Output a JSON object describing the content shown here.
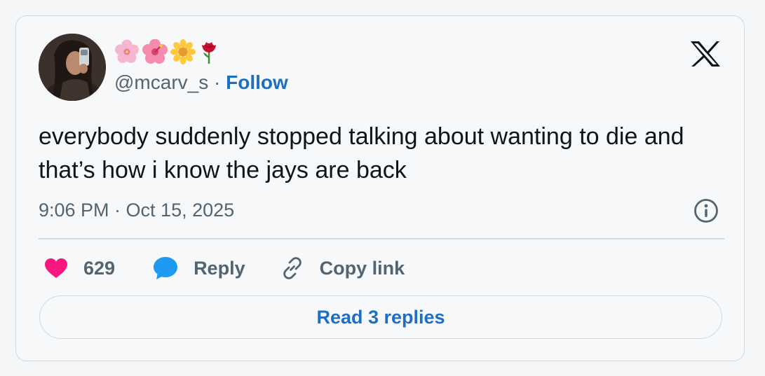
{
  "author": {
    "display_name_emojis": [
      "cherry-blossom",
      "hibiscus",
      "sunflower",
      "rose"
    ],
    "handle": "@mcarv_s",
    "separator": "·",
    "follow_label": "Follow"
  },
  "tweet": {
    "text": "everybody suddenly stopped talking about wanting to die and that’s how i know the jays are back",
    "timestamp": "9:06 PM · Oct 15, 2025"
  },
  "actions": {
    "like_count": "629",
    "reply_label": "Reply",
    "copy_link_label": "Copy link"
  },
  "read_replies_label": "Read 3 replies",
  "colors": {
    "like": "#f91880",
    "reply": "#1d9bf0",
    "link": "#1d6fc2",
    "secondary_text": "#536471",
    "primary_text": "#0f1419",
    "border": "#cfd9de"
  },
  "icons": {
    "brand": "x-logo",
    "info": "info-icon",
    "like": "heart-icon",
    "reply": "speech-bubble-icon",
    "copy": "link-icon"
  }
}
